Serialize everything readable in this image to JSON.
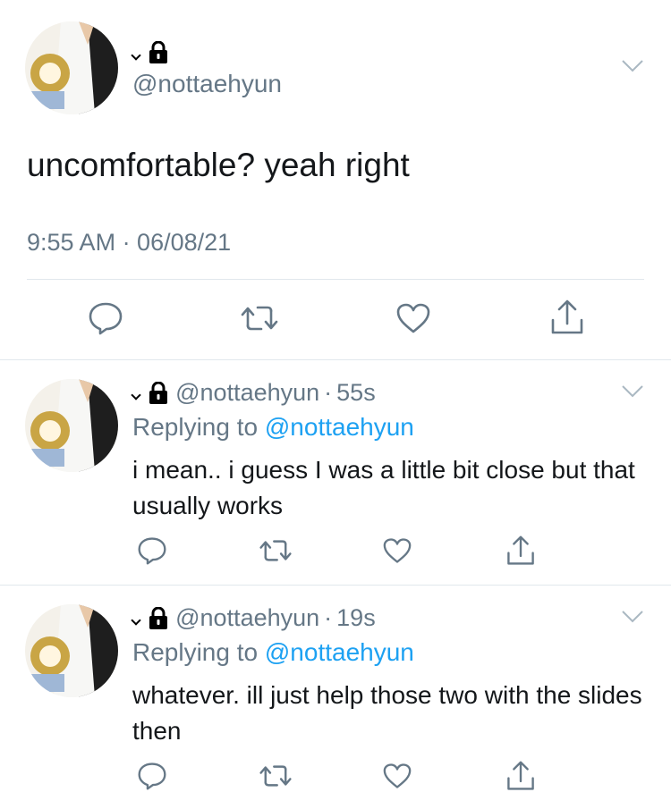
{
  "main_tweet": {
    "handle": "@nottaehyun",
    "text": "uncomfortable? yeah right",
    "timestamp": "9:55 AM · 06/08/21",
    "icons": [
      "reply-icon",
      "retweet-icon",
      "like-icon",
      "share-icon"
    ]
  },
  "replies": [
    {
      "handle": "@nottaehyun",
      "time": "55s",
      "replying_label": "Replying to",
      "replying_to": "@nottaehyun",
      "text": "i mean.. i guess I was a little bit close but that usually works"
    },
    {
      "handle": "@nottaehyun",
      "time": "19s",
      "replying_label": "Replying to",
      "replying_to": "@nottaehyun",
      "text": "whatever. ill just help those two with the slides then"
    }
  ],
  "colors": {
    "text": "#14171a",
    "muted": "#657786",
    "link": "#1da1f2",
    "divider": "#e1e8ed"
  }
}
